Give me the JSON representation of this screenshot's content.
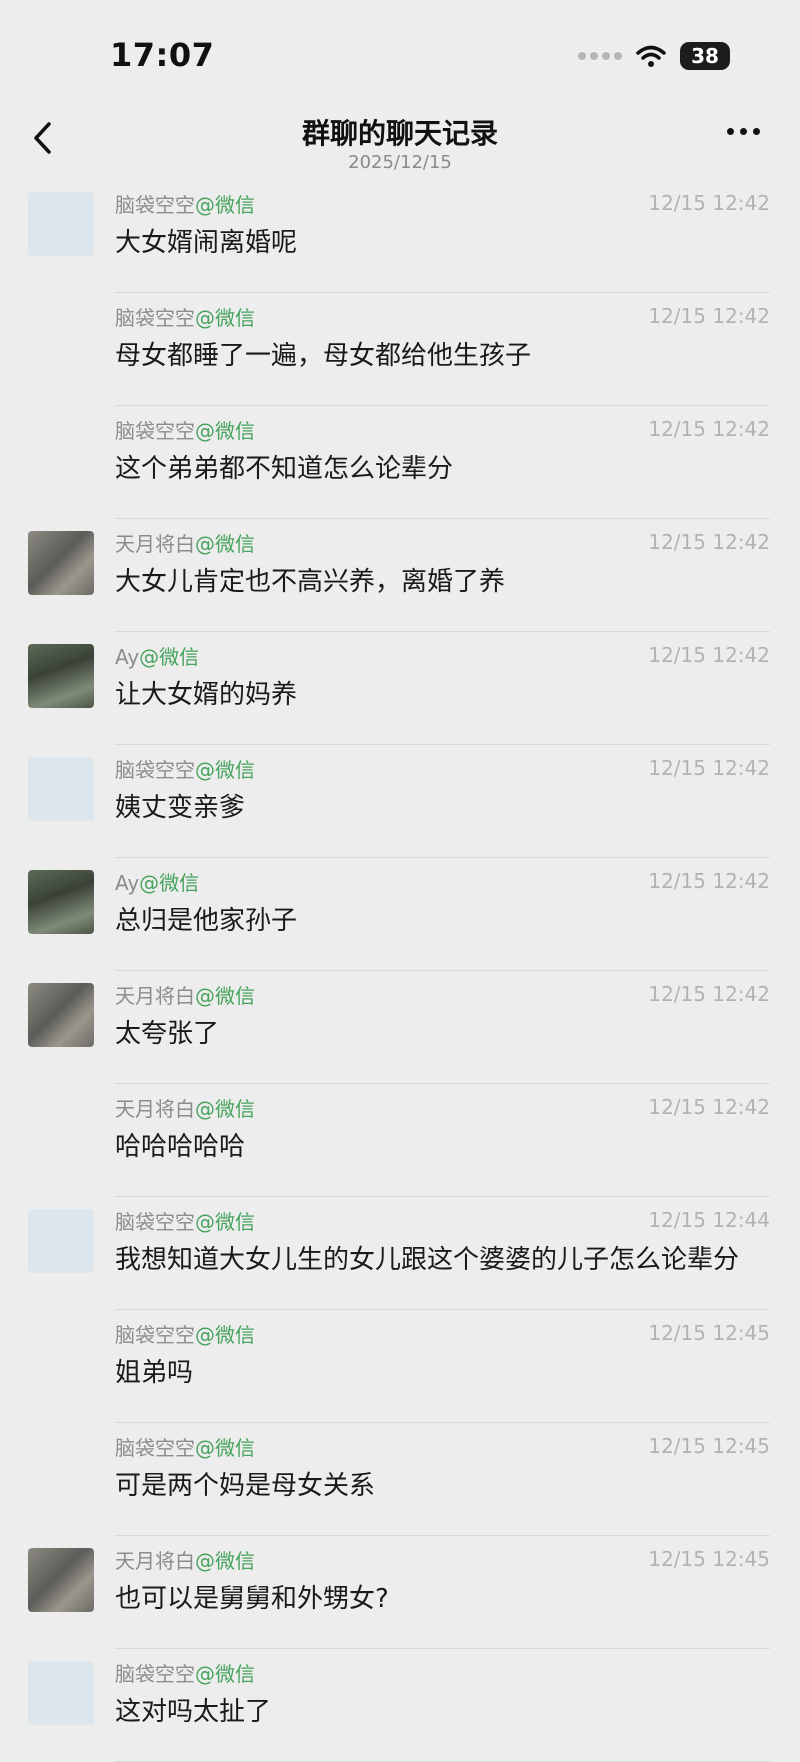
{
  "status": {
    "time": "17:07",
    "battery": "38"
  },
  "header": {
    "title": "群聊的聊天记录",
    "subtitle": "2025/12/15"
  },
  "messages": [
    {
      "avatar": "placeholder",
      "sender": "脑袋空空",
      "source": "@微信",
      "time": "12/15 12:42",
      "text": "大女婿闹离婚呢"
    },
    {
      "avatar": "",
      "sender": "脑袋空空",
      "source": "@微信",
      "time": "12/15 12:42",
      "text": "母女都睡了一遍，母女都给他生孩子"
    },
    {
      "avatar": "",
      "sender": "脑袋空空",
      "source": "@微信",
      "time": "12/15 12:42",
      "text": "这个弟弟都不知道怎么论辈分"
    },
    {
      "avatar": "cat",
      "sender": "天月将白",
      "source": "@微信",
      "time": "12/15 12:42",
      "text": "大女儿肯定也不高兴养，离婚了养"
    },
    {
      "avatar": "panda",
      "sender": "Ay",
      "source": "@微信",
      "time": "12/15 12:42",
      "text": "让大女婿的妈养"
    },
    {
      "avatar": "placeholder",
      "sender": "脑袋空空",
      "source": "@微信",
      "time": "12/15 12:42",
      "text": "姨丈变亲爹"
    },
    {
      "avatar": "panda",
      "sender": "Ay",
      "source": "@微信",
      "time": "12/15 12:42",
      "text": "总归是他家孙子"
    },
    {
      "avatar": "cat",
      "sender": "天月将白",
      "source": "@微信",
      "time": "12/15 12:42",
      "text": "太夸张了"
    },
    {
      "avatar": "",
      "sender": "天月将白",
      "source": "@微信",
      "time": "12/15 12:42",
      "text": "哈哈哈哈哈"
    },
    {
      "avatar": "placeholder",
      "sender": "脑袋空空",
      "source": "@微信",
      "time": "12/15 12:44",
      "text": "我想知道大女儿生的女儿跟这个婆婆的儿子怎么论辈分"
    },
    {
      "avatar": "",
      "sender": "脑袋空空",
      "source": "@微信",
      "time": "12/15 12:45",
      "text": "姐弟吗"
    },
    {
      "avatar": "",
      "sender": "脑袋空空",
      "source": "@微信",
      "time": "12/15 12:45",
      "text": "可是两个妈是母女关系"
    },
    {
      "avatar": "cat",
      "sender": "天月将白",
      "source": "@微信",
      "time": "12/15 12:45",
      "text": "也可以是舅舅和外甥女?"
    },
    {
      "avatar": "placeholder",
      "sender": "脑袋空空",
      "source": "@微信",
      "time": "",
      "text": "这对吗太扯了"
    }
  ]
}
